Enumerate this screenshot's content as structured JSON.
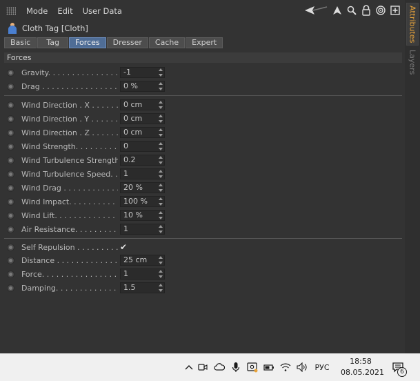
{
  "menubar": {
    "items": [
      "Mode",
      "Edit",
      "User Data"
    ],
    "icons": [
      "back-arrow-icon",
      "pointer-icon",
      "search-icon",
      "lock-icon",
      "target-icon",
      "new-panel-icon"
    ]
  },
  "title": "Cloth Tag [Cloth]",
  "tabs": [
    {
      "label": "Basic",
      "active": false
    },
    {
      "label": "Tag",
      "active": false
    },
    {
      "label": "Forces",
      "active": true
    },
    {
      "label": "Dresser",
      "active": false
    },
    {
      "label": "Cache",
      "active": false
    },
    {
      "label": "Expert",
      "active": false
    }
  ],
  "section_title": "Forces",
  "params": [
    {
      "label": "Gravity. . . . . . . . . . . . . . . . .",
      "value": "-1"
    },
    {
      "label": "Drag . . . . . . . . . . . . . . . . . .",
      "value": "0 %"
    },
    {
      "label": "Wind Direction . X . . . . . . .",
      "value": "0 cm"
    },
    {
      "label": "Wind Direction . Y . . . . . . .",
      "value": "0 cm"
    },
    {
      "label": "Wind Direction . Z . . . . . . .",
      "value": "0 cm"
    },
    {
      "label": "Wind Strength. . . . . . . . . .",
      "value": "0"
    },
    {
      "label": "Wind Turbulence Strength",
      "value": "0.2"
    },
    {
      "label": "Wind Turbulence Speed. .",
      "value": "1"
    },
    {
      "label": "Wind Drag . . . . . . . . . . . .",
      "value": "20 %"
    },
    {
      "label": "Wind Impact. . . . . . . . . . .",
      "value": "100 %"
    },
    {
      "label": "Wind Lift. . . . . . . . . . . . .",
      "value": "10 %"
    },
    {
      "label": "Air Resistance. . . . . . . . . .",
      "value": "1"
    },
    {
      "label": "Self Repulsion . . . . . . . . .",
      "value": "✔"
    },
    {
      "label": "Distance . . . . . . . . . . . . . . .",
      "value": "25 cm"
    },
    {
      "label": "Force. . . . . . . . . . . . . . . . .",
      "value": "1"
    },
    {
      "label": "Damping. . . . . . . . . . . . . . .",
      "value": "1.5"
    }
  ],
  "side_tabs": [
    {
      "label": "Attributes",
      "active": true
    },
    {
      "label": "Layers",
      "active": false
    }
  ],
  "taskbar": {
    "language": "РУС",
    "time": "18:58",
    "date": "08.05.2021",
    "notification_count": "6",
    "icons": [
      "chevron-up-icon",
      "meet-now-icon",
      "onedrive-cloud-icon",
      "microphone-icon",
      "screen-capture-icon",
      "battery-icon",
      "wifi-icon",
      "volume-icon",
      "notifications-icon"
    ]
  },
  "colors": {
    "panel_bg": "#333333",
    "tab_active": "#4f6d96",
    "side_tab_active_text": "#e8a33a",
    "taskbar_bg": "#f0f0f0"
  }
}
